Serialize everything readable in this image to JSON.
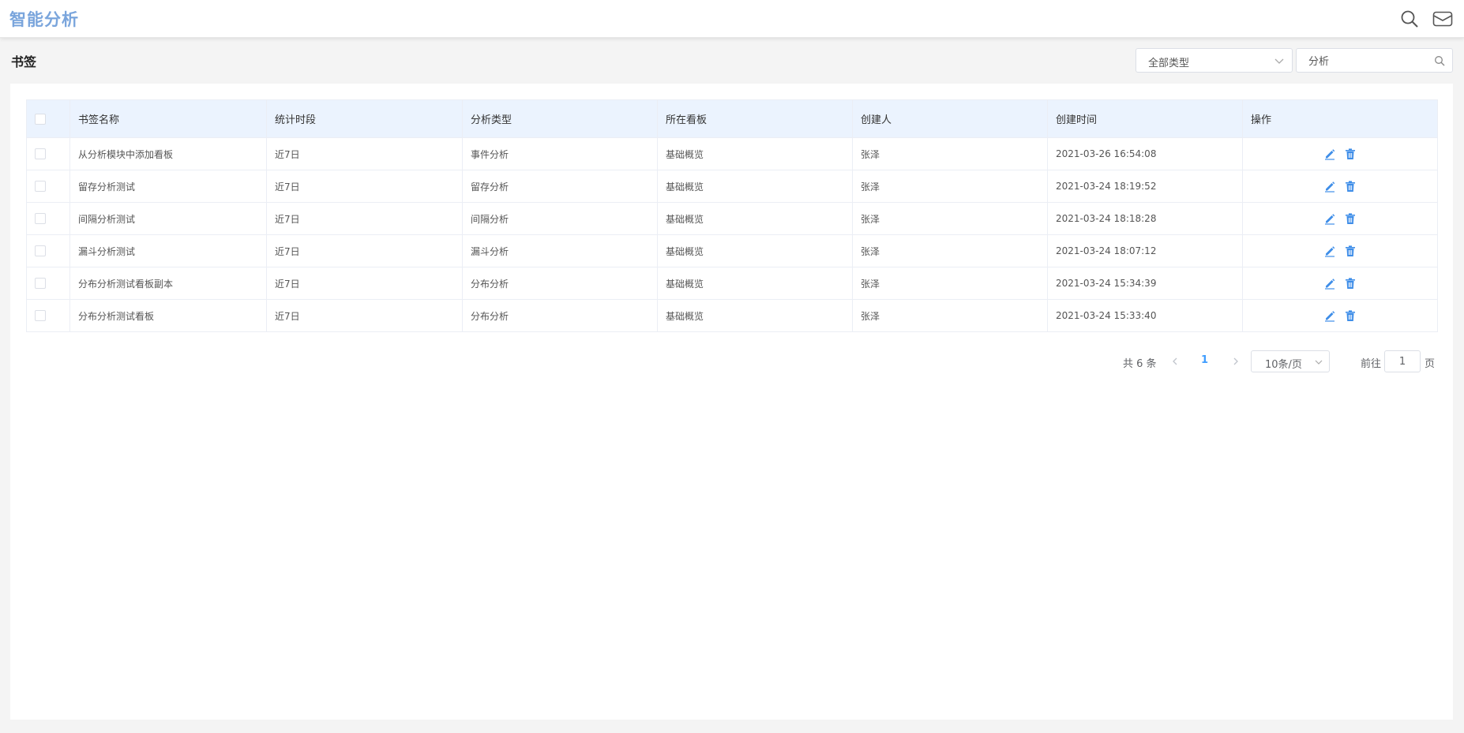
{
  "app": {
    "title": "智能分析"
  },
  "page": {
    "title": "书签"
  },
  "filters": {
    "type_selected": "全部类型",
    "search_value": "分析"
  },
  "table": {
    "columns": [
      "书签名称",
      "统计时段",
      "分析类型",
      "所在看板",
      "创建人",
      "创建时间",
      "操作"
    ],
    "rows": [
      {
        "name": "从分析模块中添加看板",
        "period": "近7日",
        "type": "事件分析",
        "board": "基础概览",
        "creator": "张泽",
        "created": "2021-03-26 16:54:08"
      },
      {
        "name": "留存分析测试",
        "period": "近7日",
        "type": "留存分析",
        "board": "基础概览",
        "creator": "张泽",
        "created": "2021-03-24 18:19:52"
      },
      {
        "name": "间隔分析测试",
        "period": "近7日",
        "type": "间隔分析",
        "board": "基础概览",
        "creator": "张泽",
        "created": "2021-03-24 18:18:28"
      },
      {
        "name": "漏斗分析测试",
        "period": "近7日",
        "type": "漏斗分析",
        "board": "基础概览",
        "creator": "张泽",
        "created": "2021-03-24 18:07:12"
      },
      {
        "name": "分布分析测试看板副本",
        "period": "近7日",
        "type": "分布分析",
        "board": "基础概览",
        "creator": "张泽",
        "created": "2021-03-24 15:34:39"
      },
      {
        "name": "分布分析测试看板",
        "period": "近7日",
        "type": "分布分析",
        "board": "基础概览",
        "creator": "张泽",
        "created": "2021-03-24 15:33:40"
      }
    ]
  },
  "pagination": {
    "total_text": "共 6 条",
    "current_page": "1",
    "page_size": "10条/页",
    "goto_label": "前往",
    "goto_value": "1",
    "goto_suffix": "页"
  },
  "colors": {
    "brand": "#7aa5dc",
    "accent": "#409eff",
    "header_bg": "#ebf3fe",
    "icon_blue": "#3f8ee8"
  }
}
